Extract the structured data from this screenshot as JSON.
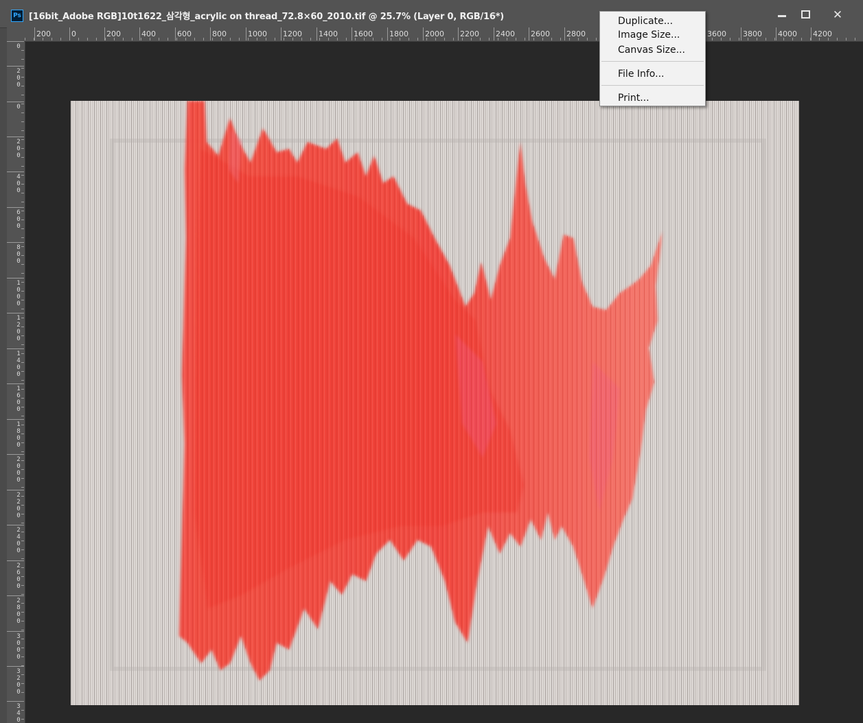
{
  "window": {
    "app_icon_label": "Ps",
    "title": "[16bit_Adobe RGB]10t1622_삼각형_acrylic on thread_72.8×60_2010.tif @ 25.7% (Layer 0, RGB/16*)",
    "minimize_icon": "minimize-icon",
    "maximize_icon": "maximize-icon",
    "close_icon": "close-icon",
    "close_glyph": "✕"
  },
  "ruler_top": {
    "labels": [
      "200",
      "0",
      "200",
      "400",
      "600",
      "800",
      "1000",
      "1200",
      "1400",
      "1600",
      "1800",
      "2000",
      "2200",
      "2400",
      "2600",
      "2800",
      "3600",
      "3800",
      "4000",
      "4200"
    ]
  },
  "ruler_left": {
    "labels": [
      "0",
      "200",
      "0",
      "200",
      "400",
      "600",
      "800",
      "1000",
      "1200",
      "1400",
      "1600",
      "1800",
      "2000",
      "2200",
      "2400",
      "2600",
      "2800",
      "3000",
      "3200",
      "340"
    ]
  },
  "context_menu": {
    "items": [
      {
        "label": "Duplicate..."
      },
      {
        "label": "Image Size..."
      },
      {
        "label": "Canvas Size..."
      },
      {
        "label": "File Info..."
      },
      {
        "label": "Print..."
      }
    ]
  },
  "colors": {
    "paint": "#f2433a",
    "thread_bg": "#dcd7d4",
    "workspace": "#282828",
    "chrome": "#535353"
  }
}
